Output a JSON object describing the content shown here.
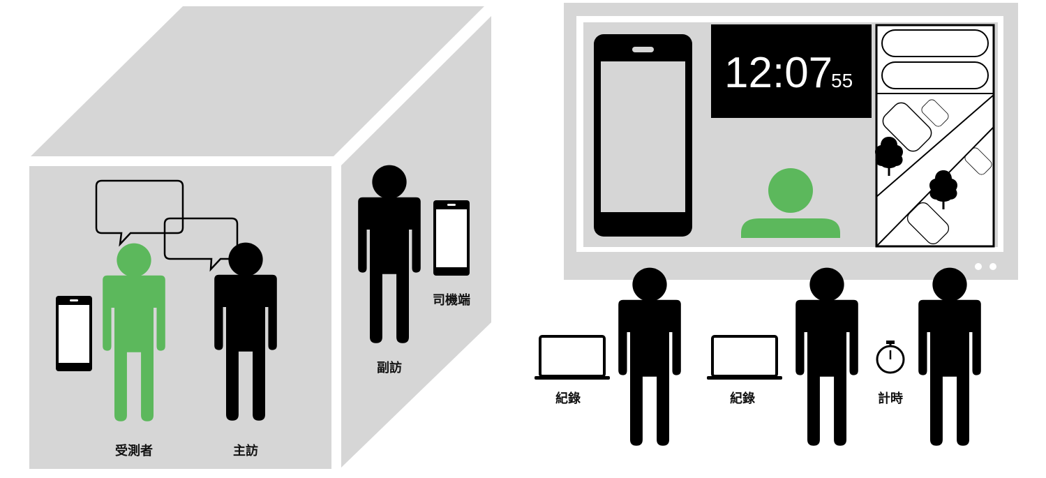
{
  "labels": {
    "subject": "受測者",
    "main_interviewer": "主訪",
    "assistant_interviewer": "副訪",
    "driver_device": "司機端",
    "record_1": "紀錄",
    "record_2": "紀錄",
    "timer": "計時"
  },
  "clock": {
    "time": "12:07",
    "seconds": "55"
  },
  "colors": {
    "box_gray": "#d6d6d6",
    "subject_green": "#5cb85c",
    "person_black": "#000000",
    "clock_bg": "#000000"
  },
  "icons": [
    "person-icon",
    "smartphone-icon",
    "speech-bubble-icon",
    "laptop-icon",
    "stopwatch-icon",
    "tree-icon",
    "car-icon",
    "avatar-icon"
  ]
}
